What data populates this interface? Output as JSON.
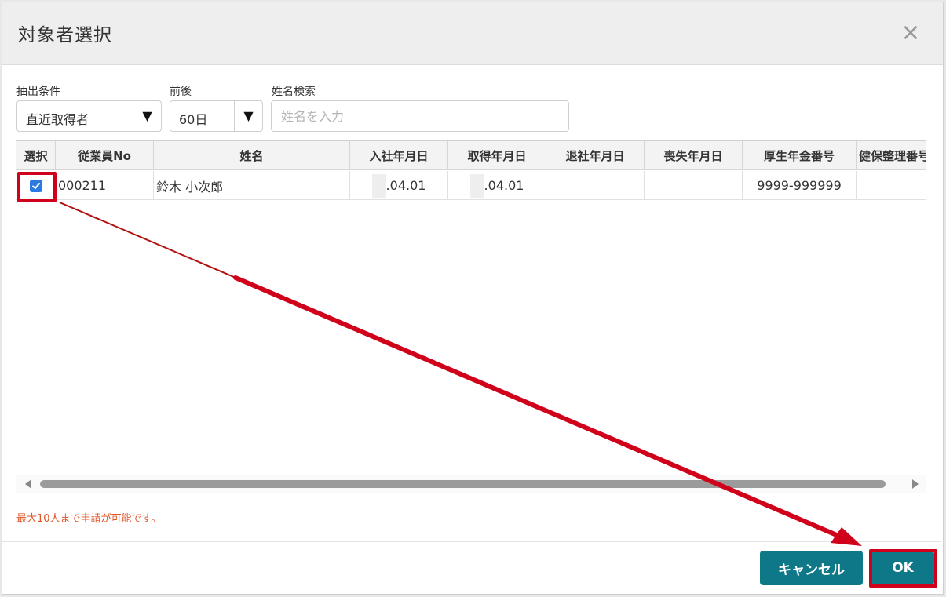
{
  "dialog": {
    "title": "対象者選択",
    "close_glyph": "×"
  },
  "filters": {
    "condition": {
      "label": "抽出条件",
      "value": "直近取得者"
    },
    "range": {
      "label": "前後",
      "value": "60日"
    },
    "name_search": {
      "label": "姓名検索",
      "placeholder": "姓名を入力",
      "value": ""
    },
    "dropdown_glyph": "▼"
  },
  "table": {
    "columns": [
      "選択",
      "従業員No",
      "姓名",
      "入社年月日",
      "取得年月日",
      "退社年月日",
      "喪失年月日",
      "厚生年金番号",
      "健保整理番号"
    ],
    "rows": [
      {
        "selected": true,
        "employee_no": "000211",
        "name": "鈴木 小次郎",
        "hire_date": ".04.01",
        "acquisition_date": ".04.01",
        "retire_date": "",
        "loss_date": "",
        "pension_no": "9999-999999",
        "insurance_no": ""
      }
    ]
  },
  "note": "最大10人まで申請が可能です。",
  "buttons": {
    "cancel": "キャンセル",
    "ok": "OK"
  },
  "colors": {
    "accent": "#0e7889",
    "highlight": "#d0021b",
    "note": "#e0562a",
    "checkbox": "#2a7ae2"
  }
}
